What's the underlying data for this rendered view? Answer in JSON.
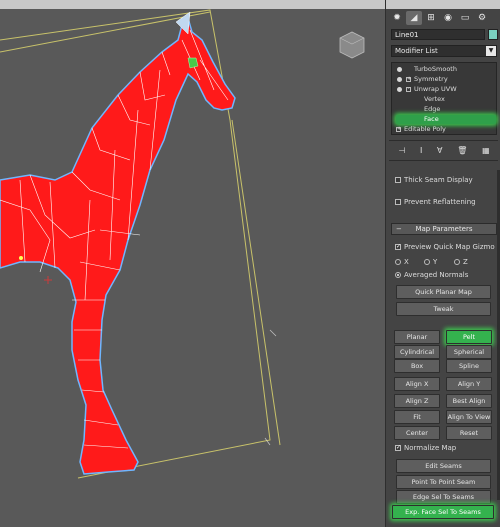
{
  "object_name": "Line01",
  "modifier_list_label": "Modifier List",
  "stack": [
    {
      "label": "TurboSmooth",
      "bulb": true,
      "box": ""
    },
    {
      "label": "Symmetry",
      "bulb": true,
      "box": "+"
    },
    {
      "label": "Unwrap UVW",
      "bulb": true,
      "box": "-"
    },
    {
      "label": "Vertex"
    },
    {
      "label": "Edge"
    },
    {
      "label": "Face",
      "selected": true
    },
    {
      "label": "Editable Poly",
      "box": "+"
    }
  ],
  "options": {
    "thick_seam": "Thick Seam Display",
    "prevent_reflattening": "Prevent Reflattening"
  },
  "map_parameters": {
    "title": "Map Parameters",
    "preview_gizmo": "Preview Quick Map Gizmo",
    "x": "X",
    "y": "Y",
    "z": "Z",
    "averaged_normals": "Averaged Normals",
    "quick_planar_map": "Quick Planar Map",
    "tweak": "Tweak",
    "planar": "Planar",
    "pelt": "Pelt",
    "cylindrical": "Cylindrical",
    "spherical": "Spherical",
    "box": "Box",
    "spline": "Spline",
    "align_x": "Align X",
    "align_y": "Align Y",
    "align_z": "Align Z",
    "best_align": "Best Align",
    "fit": "Fit",
    "align_to_view": "Align To View",
    "center": "Center",
    "reset": "Reset",
    "normalize_map": "Normalize Map",
    "edit_seams": "Edit Seams",
    "point_to_point_seam": "Point To Point Seam",
    "edge_sel_to_seams": "Edge Sel To Seams",
    "exp_face_sel_to_seams": "Exp. Face Sel To Seams"
  },
  "colors": {
    "mesh": "#ff1a1a",
    "wire": "#ffffff",
    "highlight": "#34b24e",
    "viewport_bg": "#595959",
    "bbox": "#c8c26a"
  }
}
